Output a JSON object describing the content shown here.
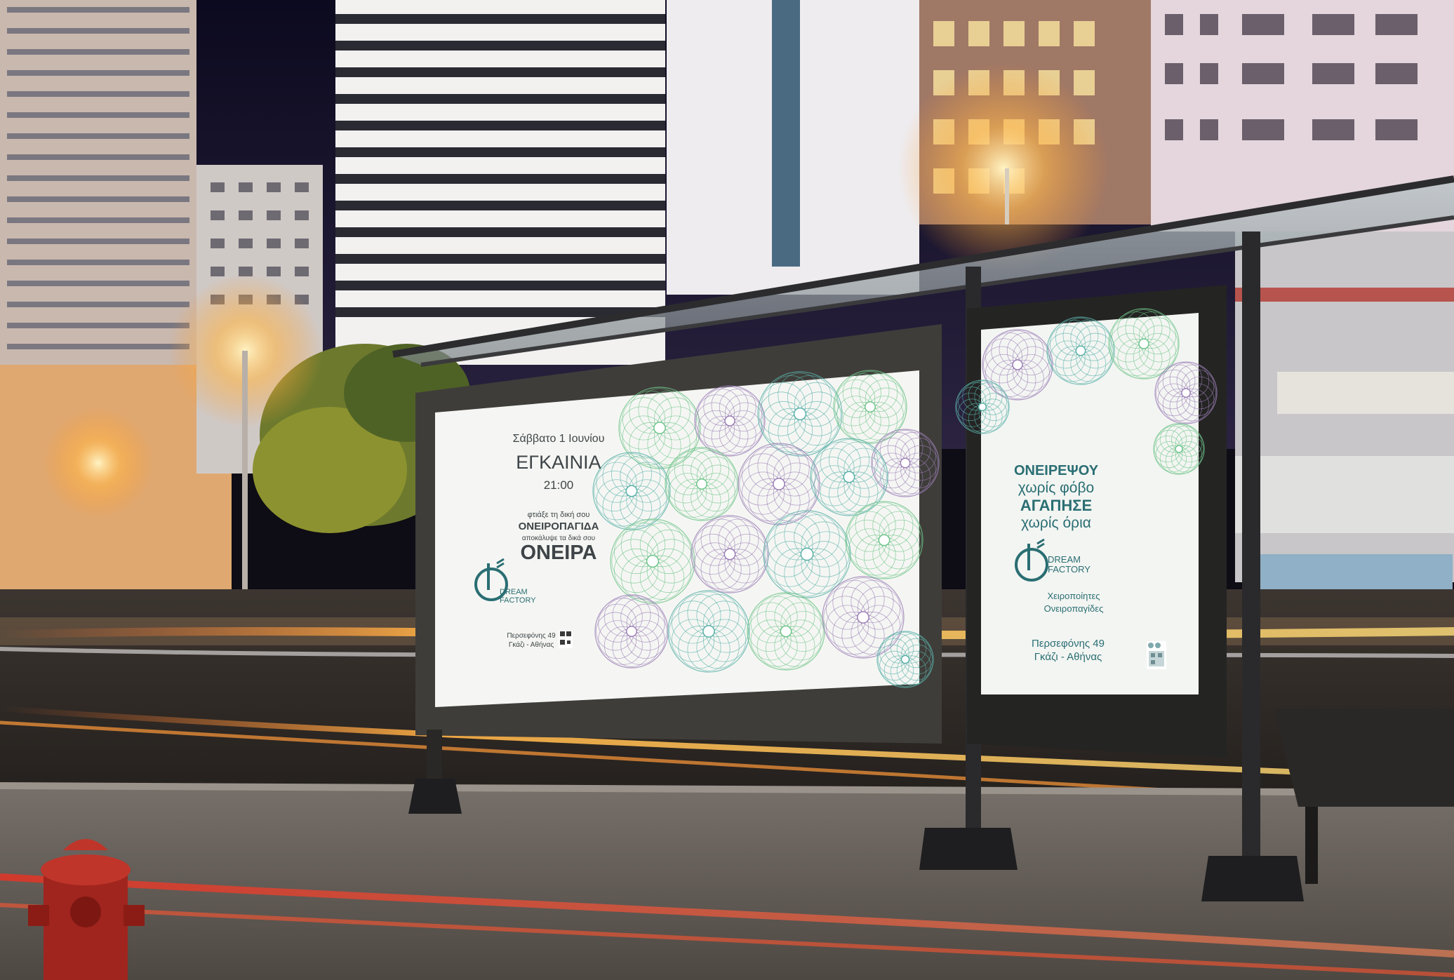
{
  "large_poster": {
    "date": "Σάββατο 1 Ιουνίου",
    "event": "ΕΓΚΑΙΝΙΑ",
    "time": "21:00",
    "line1": "φτιάξε τη δική σου",
    "line2": "ΟΝΕΙΡΟΠΑΓΙΔΑ",
    "line3": "αποκάλυψε τα δικά σου",
    "line4": "ΟΝΕΙΡΑ",
    "brand_line1": "DREAM",
    "brand_line2": "FACTORY",
    "address_line1": "Περσεφόνης 49",
    "address_line2": "Γκάζι - Αθήνας"
  },
  "small_poster": {
    "line1": "ΟΝΕΙΡΕΨΟΥ",
    "line2": "χωρίς φόβο",
    "line3": "ΑΓΑΠΗΣΕ",
    "line4": "χωρίς όρια",
    "brand_line1": "DREAM",
    "brand_line2": "FACTORY",
    "tagline_line1": "Χειροποίητες",
    "tagline_line2": "Ονειροπαγίδες",
    "address_line1": "Περσεφόνης 49",
    "address_line2": "Γκάζι - Αθήνας"
  },
  "colors": {
    "brand_teal": "#2a6e73",
    "pattern_green": "#6fc48a",
    "pattern_purple": "#9b7fb6",
    "pattern_teal": "#5ab0a8"
  }
}
